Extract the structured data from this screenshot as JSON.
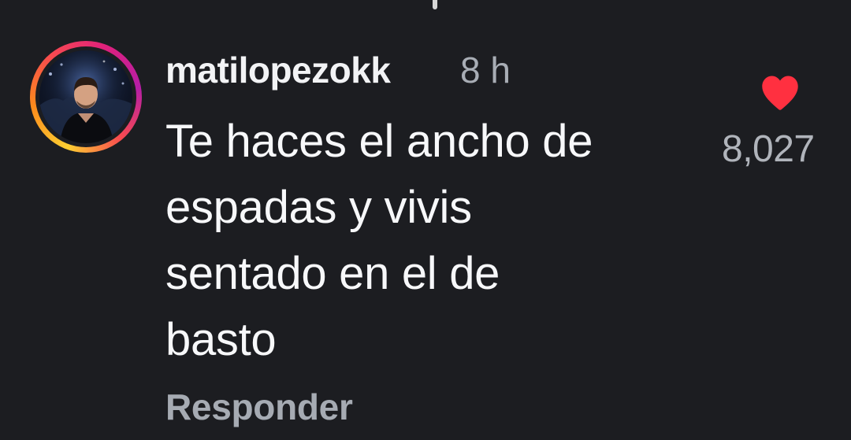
{
  "comment": {
    "username": "matilopezokk",
    "timestamp": "8 h",
    "text_lines": [
      "Te haces el ancho de",
      "espadas y vivis",
      "sentado en el de",
      "basto"
    ],
    "reply_label": "Responder",
    "avatar_icon": "profile-photo",
    "story_ring_colors": [
      "#fdcf32",
      "#fb8a1c",
      "#f84a4f",
      "#e0217b",
      "#b51ea6"
    ]
  },
  "likes": {
    "icon": "heart-icon",
    "count": "8,027",
    "liked": true,
    "color": "#ff3040"
  }
}
